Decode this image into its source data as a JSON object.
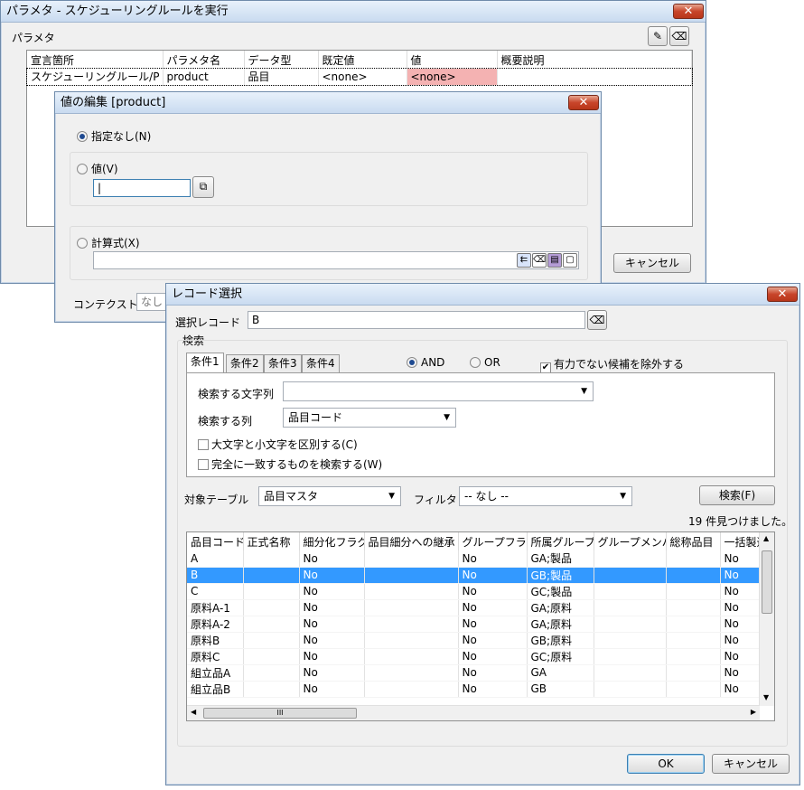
{
  "param_dialog": {
    "title": "パラメタ - スケジューリングルールを実行",
    "group_label": "パラメタ",
    "columns": [
      "宣言箇所",
      "パラメタ名",
      "データ型",
      "既定値",
      "値",
      "概要説明"
    ],
    "row": {
      "declared_at": "スケジューリングルール/P",
      "param_name": "product",
      "data_type": "品目",
      "default": "<none>",
      "value": "<none>",
      "description": ""
    },
    "cancel_label": "キャンセル"
  },
  "value_editor": {
    "title": "値の編集 [product]",
    "opt_none_label": "指定なし(N)",
    "opt_value_label": "値(V)",
    "value_input": "|",
    "opt_formula_label": "計算式(X)",
    "formula_input": "",
    "context_label": "コンテクスト",
    "context_value": "なし"
  },
  "record_dialog": {
    "title": "レコード選択",
    "selected_label": "選択レコード",
    "selected_value": "B",
    "search_group_label": "検索",
    "tabs": [
      "条件1",
      "条件2",
      "条件3",
      "条件4"
    ],
    "and_label": "AND",
    "or_label": "OR",
    "exclude_invalid_label": "有力でない候補を除外する",
    "search_string_label": "検索する文字列",
    "search_string_value": "",
    "search_column_label": "検索する列",
    "search_column_value": "品目コード",
    "case_sensitive_label": "大文字と小文字を区別する(C)",
    "exact_match_label": "完全に一致するものを検索する(W)",
    "table_label": "対象テーブル",
    "table_value": "品目マスタ",
    "filter_label": "フィルタ",
    "filter_value": "-- なし --",
    "search_button": "検索(F)",
    "result_count": "19 件見つけました。",
    "columns": [
      "品目コード",
      "正式名称",
      "細分化フラグ",
      "品目細分への継承",
      "グループフラグ",
      "所属グループ",
      "グループメンバ",
      "総称品目",
      "一括製造"
    ],
    "rows": [
      [
        "A",
        "",
        "No",
        "",
        "No",
        "GA;製品",
        "",
        "",
        "No"
      ],
      [
        "B",
        "",
        "No",
        "",
        "No",
        "GB;製品",
        "",
        "",
        "No"
      ],
      [
        "C",
        "",
        "No",
        "",
        "No",
        "GC;製品",
        "",
        "",
        "No"
      ],
      [
        "原料A-1",
        "",
        "No",
        "",
        "No",
        "GA;原料",
        "",
        "",
        "No"
      ],
      [
        "原料A-2",
        "",
        "No",
        "",
        "No",
        "GA;原料",
        "",
        "",
        "No"
      ],
      [
        "原料B",
        "",
        "No",
        "",
        "No",
        "GB;原料",
        "",
        "",
        "No"
      ],
      [
        "原料C",
        "",
        "No",
        "",
        "No",
        "GC;原料",
        "",
        "",
        "No"
      ],
      [
        "組立品A",
        "",
        "No",
        "",
        "No",
        "GA",
        "",
        "",
        "No"
      ],
      [
        "組立品B",
        "",
        "No",
        "",
        "No",
        "GB",
        "",
        "",
        "No"
      ]
    ],
    "selected_row_index": 1,
    "hscroll_grip": "III",
    "ok_label": "OK",
    "cancel_label": "キャンセル"
  }
}
